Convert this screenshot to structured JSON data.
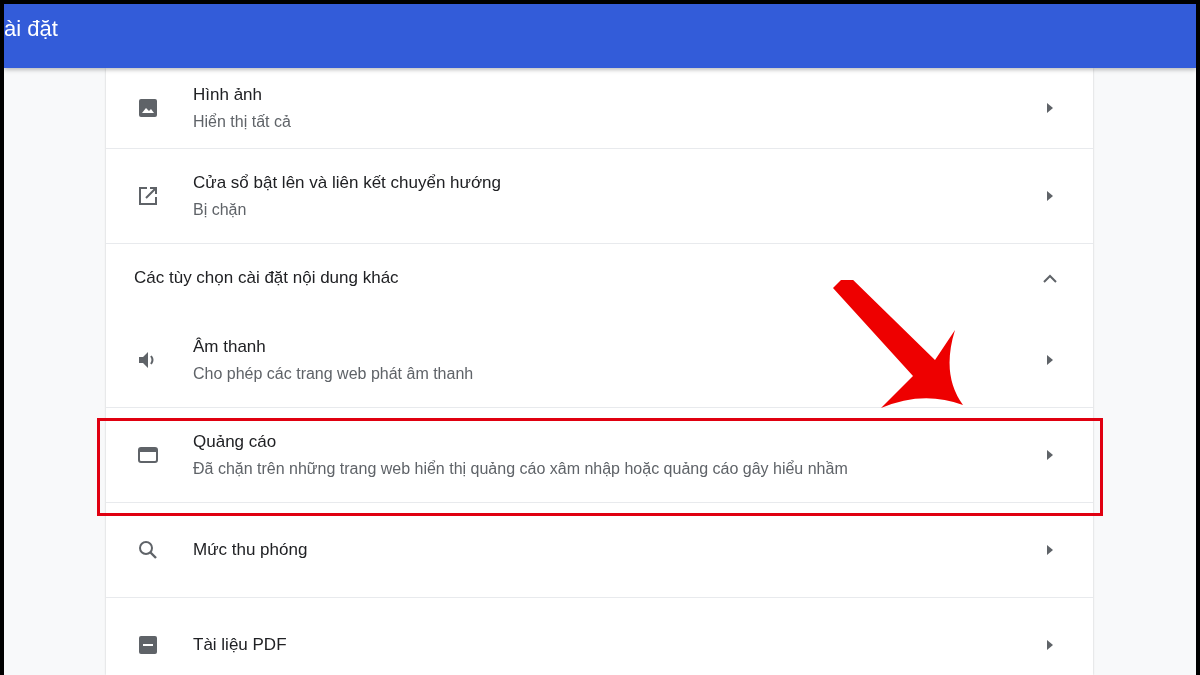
{
  "header": {
    "title": "ài đặt"
  },
  "rows": [
    {
      "kind": "item",
      "title": "Hình ảnh",
      "subtitle": "Hiển thị tất cả",
      "highlighted": false
    },
    {
      "kind": "item",
      "title": "Cửa sổ bật lên và liên kết chuyển hướng",
      "subtitle": "Bị chặn",
      "highlighted": false
    },
    {
      "kind": "section",
      "title": "Các tùy chọn cài đặt nội dung khác",
      "expanded": true
    },
    {
      "kind": "item",
      "title": "Âm thanh",
      "subtitle": "Cho phép các trang web phát âm thanh",
      "highlighted": false
    },
    {
      "kind": "item",
      "title": "Quảng cáo",
      "subtitle": "Đã chặn trên những trang web hiển thị quảng cáo xâm nhập hoặc quảng cáo gây hiểu nhầm",
      "highlighted": true
    },
    {
      "kind": "item",
      "title": "Mức thu phóng",
      "highlighted": false
    },
    {
      "kind": "item",
      "title": "Tài liệu PDF",
      "highlighted": false
    }
  ]
}
